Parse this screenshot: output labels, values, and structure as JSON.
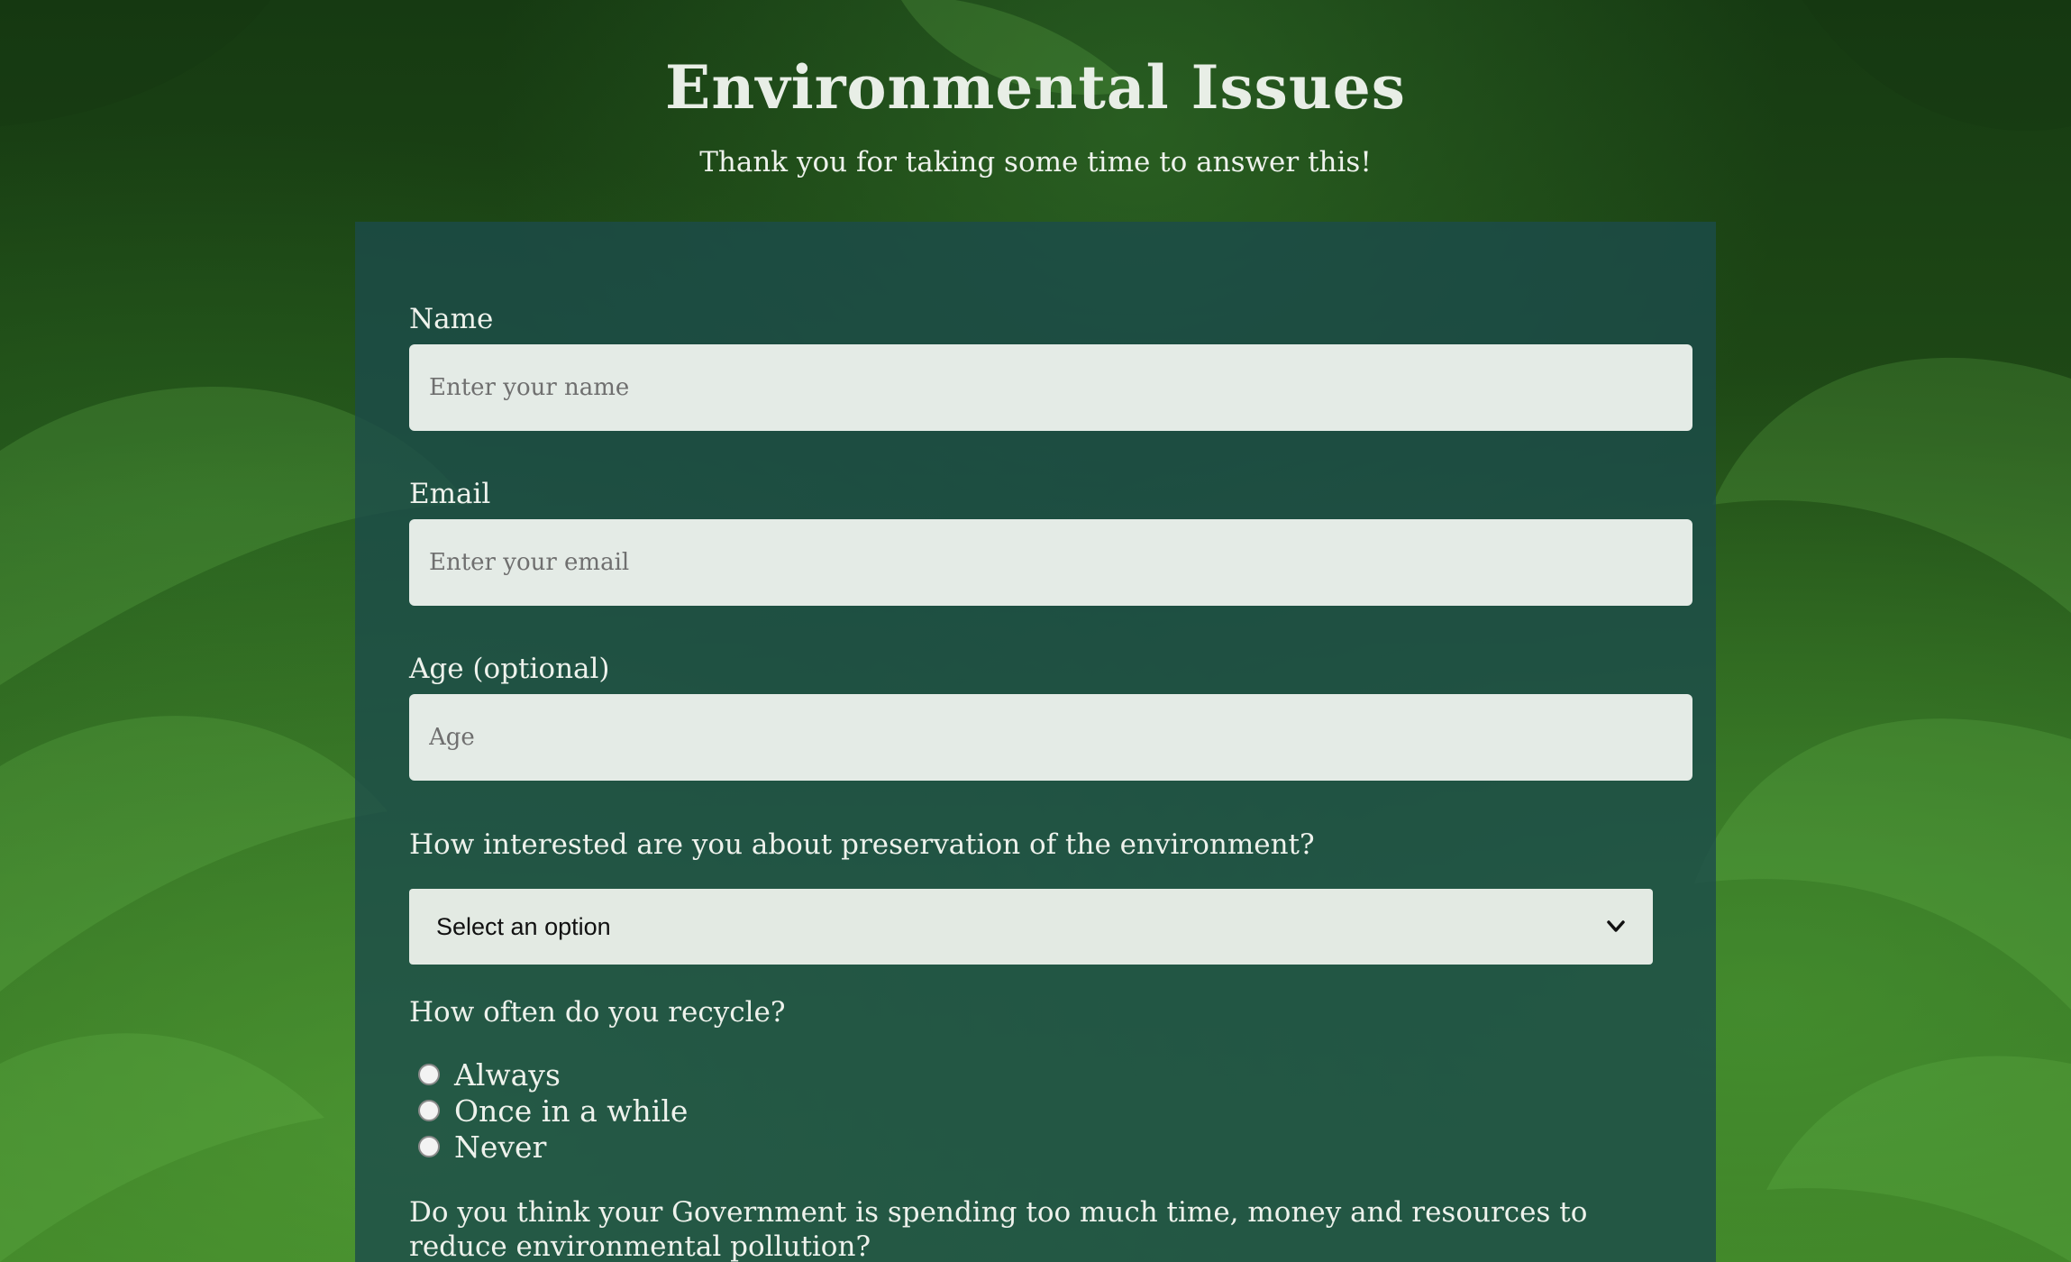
{
  "header": {
    "title": "Environmental Issues",
    "subtitle": "Thank you for taking some time to answer this!"
  },
  "form": {
    "name": {
      "label": "Name",
      "placeholder": "Enter your name"
    },
    "email": {
      "label": "Email",
      "placeholder": "Enter your email"
    },
    "age": {
      "label": "Age (optional)",
      "placeholder": "Age"
    },
    "interest": {
      "question": "How interested are you about preservation of the environment?",
      "selected": "Select an option"
    },
    "recycle": {
      "question": "How often do you recycle?",
      "options": [
        "Always",
        "Once in a while",
        "Never"
      ]
    },
    "government": {
      "question": "Do you think your Government is spending too much time, money and resources to reduce environmental pollution?"
    }
  },
  "icons": {
    "select_arrow": "chevron-down-icon"
  },
  "colors": {
    "panel": "#1b4b4b",
    "background": "#1f4a16",
    "input_bg": "#f5f8f4"
  }
}
